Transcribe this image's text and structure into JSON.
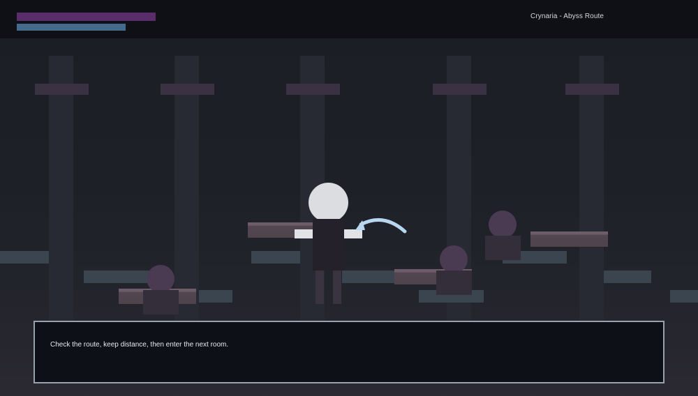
{
  "hud": {
    "title": "Crynaria - Abyss Route",
    "health": {
      "fraction": 0.56,
      "color": "#5a2d6a"
    },
    "mana": {
      "fraction": 0.44,
      "color": "#456a8c"
    }
  },
  "dialog": {
    "text": "Check the route, keep distance, then enter the next room."
  },
  "player": {
    "facing": "right",
    "action": "sword-slash"
  },
  "colors": {
    "background": "#1b1e24",
    "pillar": "#272a33",
    "enemy": "#4a3a52",
    "player_head": "#dcdde1",
    "slash": "#b9d6f0"
  }
}
